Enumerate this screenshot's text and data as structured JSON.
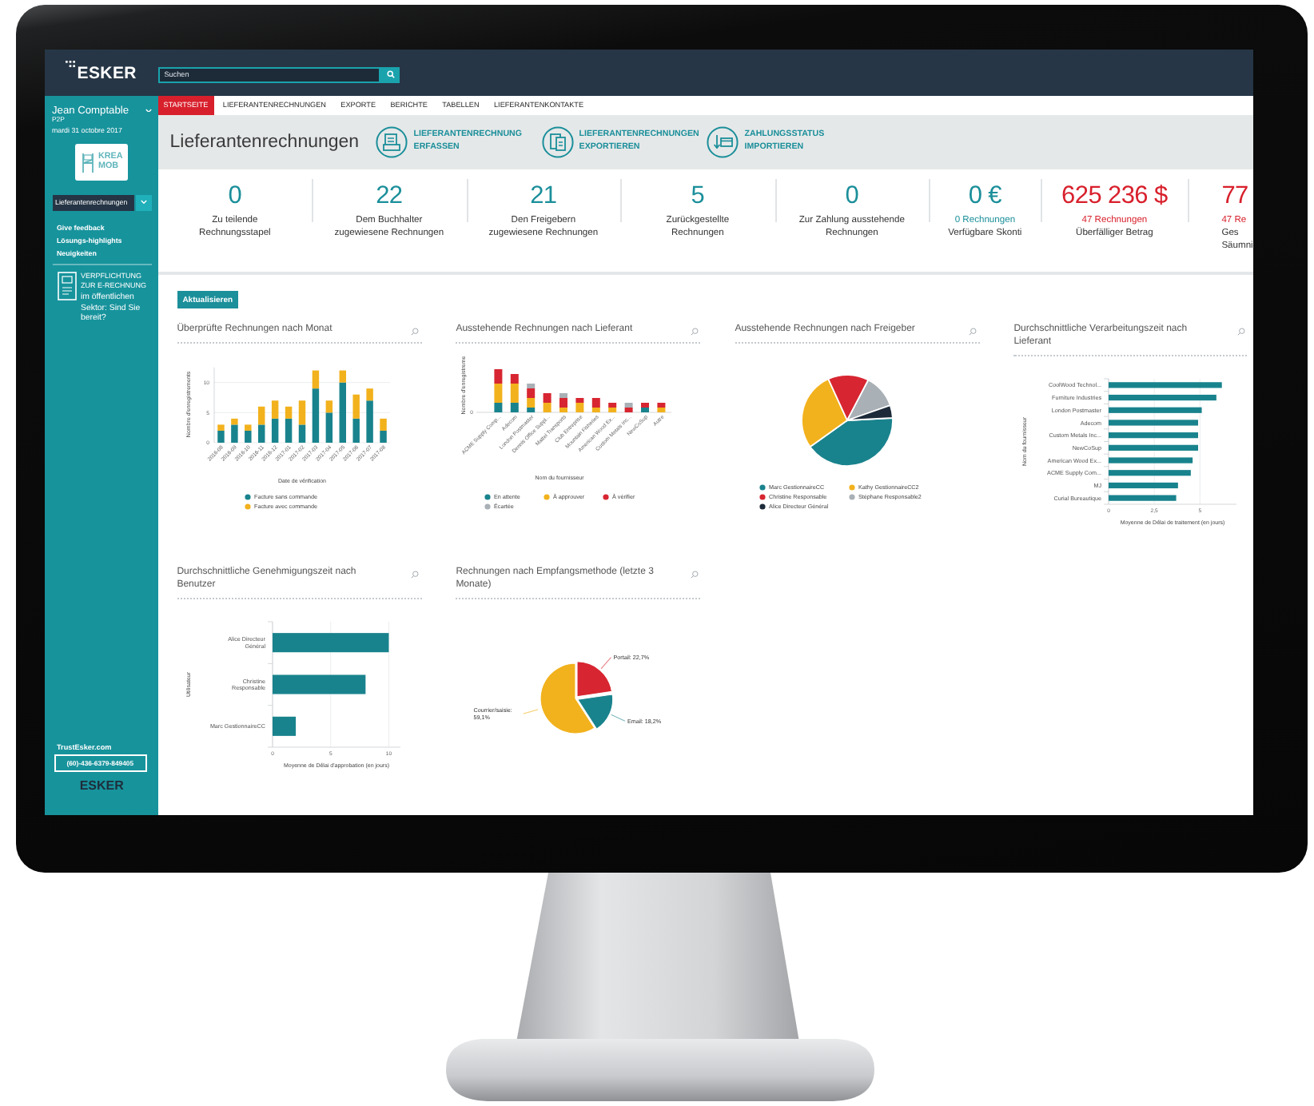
{
  "top_bar": {
    "logo": "ESKER",
    "search": {
      "placeholder": "Suchen"
    }
  },
  "sidebar": {
    "user_name": "Jean Comptable",
    "role": "P2P",
    "date": "mardi 31 octobre 2017",
    "company_logo": [
      "KREA",
      "MOB"
    ],
    "module_select": {
      "value": "Lieferantenrechnungen"
    },
    "links": [
      "Give feedback",
      "Lösungs-highlights",
      "Neuigkeiten"
    ],
    "promo": {
      "title": "VERPFLICHTUNG ZUR E-RECHNUNG",
      "text": "im öffentlichen Sektor: Sind Sie bereit?"
    },
    "footer": {
      "link": "TrustEsker.com",
      "phone": "(60)-436-6379-849405",
      "logo": "ESKER"
    }
  },
  "nav_tabs": [
    {
      "label": "STARTSEITE",
      "selected": true
    },
    {
      "label": "LIEFERANTENRECHNUNGEN",
      "selected": false
    },
    {
      "label": "EXPORTE",
      "selected": false
    },
    {
      "label": "BERICHTE",
      "selected": false
    },
    {
      "label": "TABELLEN",
      "selected": false
    },
    {
      "label": "LIEFERANTENKONTAKTE",
      "selected": false
    }
  ],
  "page_header": {
    "title": "Lieferantenrechnungen",
    "actions": [
      {
        "kind": "capture",
        "label": "LIEFERANTENRECHNUNG ERFASSEN"
      },
      {
        "kind": "export",
        "label": "LIEFERANTENRECHNUNGEN EXPORTIEREN"
      },
      {
        "kind": "import",
        "label": "ZAHLUNGSSTATUS IMPORTIEREN"
      }
    ]
  },
  "kpis": [
    {
      "value": "0",
      "label": [
        "Zu teilende",
        "Rechnungsstapel"
      ],
      "alert": false
    },
    {
      "value": "22",
      "label": [
        "Dem Buchhalter",
        "zugewiesene Rechnungen"
      ],
      "alert": false
    },
    {
      "value": "21",
      "label": [
        "Den Freigebern",
        "zugewiesene Rechnungen"
      ],
      "alert": false
    },
    {
      "value": "5",
      "label": [
        "Zurückgestellte",
        "Rechnungen"
      ],
      "alert": false
    },
    {
      "value": "0",
      "label": [
        "Zur Zahlung ausstehende",
        "Rechnungen"
      ],
      "alert": false
    },
    {
      "value": "0 €",
      "detail": "0 Rechnungen",
      "label": [
        "Verfügbare Skonti"
      ],
      "alert": false
    },
    {
      "value": "625 236 $",
      "detail": "47 Rechnungen",
      "label": [
        "Überfälliger Betrag"
      ],
      "alert": true
    },
    {
      "value": "77",
      "detail": "47 Re",
      "label": [
        "Ges",
        "Säumni"
      ],
      "alert": true
    }
  ],
  "refresh_button": "Aktualisieren",
  "charts": [
    {
      "title": "Überprüfte Rechnungen nach Monat",
      "chart_data": {
        "type": "bar",
        "stacked": true,
        "xlabel": "Date de vérification",
        "ylabel": "Nombre d'enregistrements",
        "categories": [
          "2016-08",
          "2016-09",
          "2016-10",
          "2016-11",
          "2016-12",
          "2017-01",
          "2017-02",
          "2017-03",
          "2017-04",
          "2017-05",
          "2017-06",
          "2017-07",
          "2017-08"
        ],
        "series": [
          {
            "name": "Facture sans commande",
            "color": "#19838d",
            "values": [
              2,
              3,
              2,
              3,
              4,
              4,
              3,
              9,
              5,
              10,
              4,
              7,
              2
            ]
          },
          {
            "name": "Facture avec commande",
            "color": "#f2b21d",
            "values": [
              1,
              1,
              1,
              3,
              3,
              2,
              4,
              3,
              2,
              2,
              4,
              2,
              2
            ]
          }
        ],
        "ylim": [
          0,
          12.5
        ],
        "yticks": [
          0,
          5,
          10
        ],
        "legend": "bottom"
      }
    },
    {
      "kind": "supplier_bars",
      "title": "Ausstehende Rechnungen nach Lieferant",
      "ylabel": "Nombre d'enregistreme",
      "ytick": "0",
      "xlabel": "Nom du fournisseur",
      "categories": [
        "ACME Supply Comp...",
        "Adecom",
        "London Postmaster",
        "Dennis Office Suppl...",
        "Mattel Transports",
        "Club Entreprise",
        "Mountain Fisheries",
        "American Wood Ex...",
        "Custom Metals Inc...",
        "NewCoSup",
        "Autre"
      ],
      "legend": [
        {
          "name": "En attente",
          "color": "#19838d"
        },
        {
          "name": "À approuver",
          "color": "#f2b21d"
        },
        {
          "name": "À vérifier",
          "color": "#d72631"
        },
        {
          "name": "Écartée",
          "color": "#a9b0b6"
        }
      ]
    },
    {
      "kind": "pie_legend",
      "title": "Ausstehende Rechnungen nach Freigeber",
      "legend": [
        {
          "name": "Marc GestionnaireCC",
          "color": "#19838d"
        },
        {
          "name": "Kathy GestionnaireCC2",
          "color": "#f2b21d"
        },
        {
          "name": "Christine Responsable",
          "color": "#d72631"
        },
        {
          "name": "Stéphane Responsable2",
          "color": "#a9b0b6"
        },
        {
          "name": "Alice Directeur Général",
          "color": "#1c2a39"
        }
      ]
    },
    {
      "title": "Durchschnittliche Verarbeitungszeit nach Lieferant",
      "chart_data": {
        "type": "bar",
        "orientation": "horizontal",
        "xlabel": "Moyenne de Délai de traitement (en jours)",
        "ylabel": "Nom du fournisseur",
        "categories": [
          "CoolWood Technol...",
          "Furniture Industries",
          "London Postmaster",
          "Adecom",
          "Custom Metals Inc...",
          "NewCoSup",
          "American Wood Ex...",
          "ACME Supply Com...",
          "MJ",
          "Curial Bureautique"
        ],
        "values": [
          6.2,
          5.9,
          5.1,
          4.9,
          4.9,
          4.9,
          4.6,
          4.5,
          3.8,
          3.7
        ],
        "xlim": [
          0,
          7
        ],
        "xticks": [
          0,
          {
            "value": 2.5,
            "label": "2,5"
          },
          5
        ]
      }
    },
    {
      "title": "Durchschnittliche Genehmigungszeit nach Benutzer",
      "chart_data": {
        "type": "bar",
        "orientation": "horizontal",
        "xlabel": "Moyenne de Délai d'approbation (en jours)",
        "ylabel": "Utilisateur",
        "categories": [
          "Alice Directeur Général",
          "Christine Responsable",
          "Marc GestionnaireCC"
        ],
        "values": [
          10,
          8,
          2
        ],
        "xlim": [
          0,
          11
        ],
        "xticks": [
          0,
          5,
          10
        ]
      }
    },
    {
      "title": "Rechnungen nach Empfangsmethode (letzte 3 Monate)",
      "chart_data": {
        "type": "pie",
        "values": [
          22.7,
          18.2,
          59.1
        ],
        "colors": [
          "#d72631",
          "#19838d",
          "#f2b21d"
        ],
        "value_labels": [
          "Portail: 22,7%",
          "Email: 18,2%",
          "Courrier/saisie: 59,1%"
        ]
      }
    }
  ]
}
